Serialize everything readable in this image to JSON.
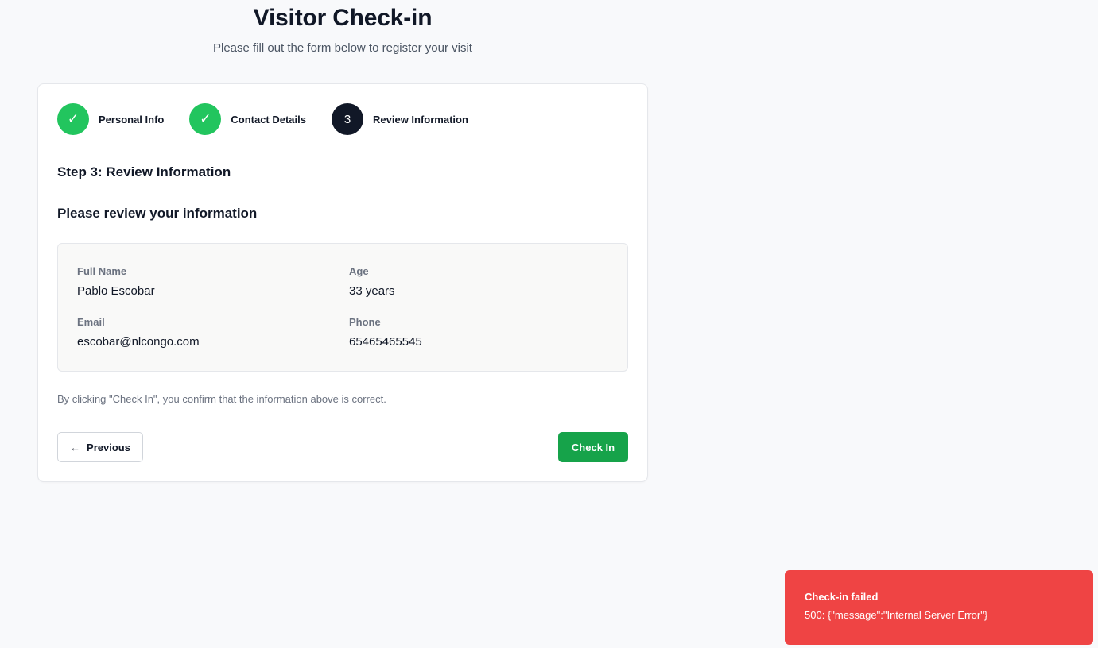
{
  "header": {
    "title": "Visitor Check-in",
    "subtitle": "Please fill out the form below to register your visit"
  },
  "stepper": {
    "steps": [
      {
        "label": "Personal Info",
        "status": "complete",
        "indicator": "✓"
      },
      {
        "label": "Contact Details",
        "status": "complete",
        "indicator": "✓"
      },
      {
        "label": "Review Information",
        "status": "current",
        "indicator": "3"
      }
    ]
  },
  "form": {
    "step_heading": "Step 3: Review Information",
    "review_heading": "Please review your information",
    "fields": {
      "full_name": {
        "label": "Full Name",
        "value": "Pablo Escobar"
      },
      "age": {
        "label": "Age",
        "value": "33 years"
      },
      "email": {
        "label": "Email",
        "value": "escobar@nlcongo.com"
      },
      "phone": {
        "label": "Phone",
        "value": "65465465545"
      }
    },
    "confirm_note": "By clicking \"Check In\", you confirm that the information above is correct.",
    "previous_arrow": "←",
    "previous_label": "Previous",
    "submit_label": "Check In"
  },
  "toast": {
    "title": "Check-in failed",
    "message": "500: {\"message\":\"Internal Server Error\"}"
  },
  "colors": {
    "step_complete": "#22c55e",
    "step_current": "#111827",
    "primary_button": "#16a34a",
    "error_toast": "#ef4444"
  }
}
